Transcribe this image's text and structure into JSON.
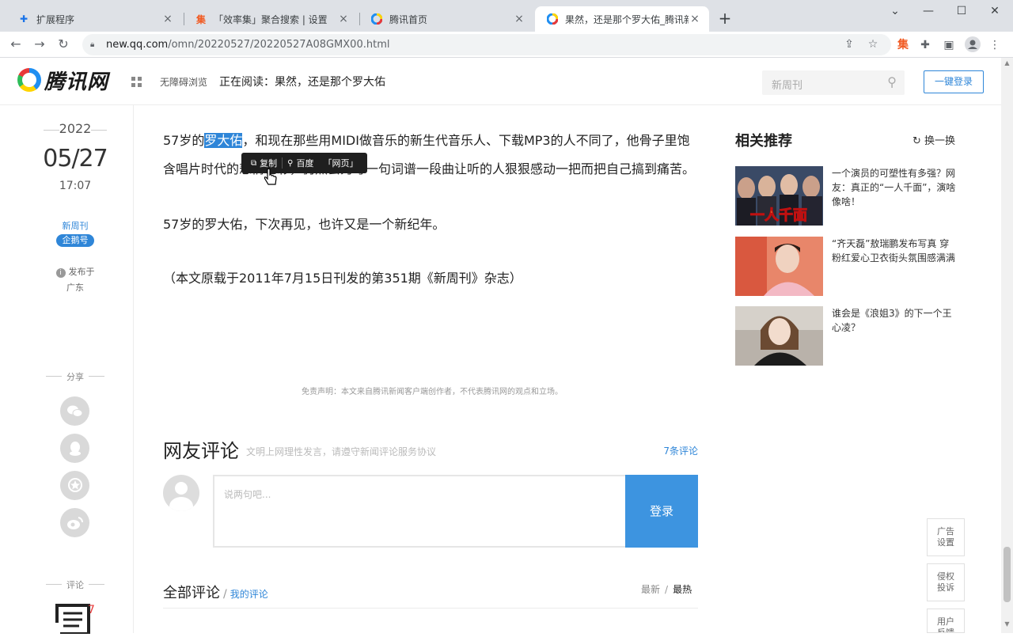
{
  "browser": {
    "tabs": [
      {
        "title": "扩展程序",
        "icon": "puzzle-icon"
      },
      {
        "title": "「效率集」聚合搜索 | 设置",
        "icon": "xiaolvji-icon"
      },
      {
        "title": "腾讯首页",
        "icon": "tencent-icon"
      },
      {
        "title": "果然，还是那个罗大佑_腾讯新闻",
        "icon": "tencent-icon"
      }
    ],
    "address": {
      "host": "new.qq.com",
      "path": "/omn/20220527/20220527A08GMX00.html"
    }
  },
  "header": {
    "logo_text": "腾讯网",
    "accessible": "无障碍浏览",
    "reading": "正在阅读：果然，还是那个罗大佑",
    "search_placeholder": "新周刊",
    "login": "一键登录"
  },
  "meta": {
    "year": "2022",
    "date": "05/27",
    "time": "17:07",
    "source": "新周刊",
    "badge": "企鹅号",
    "published_at": "发布于",
    "region": "广东",
    "share_label": "分享",
    "comment_label": "评论",
    "comment_count": "7"
  },
  "article": {
    "p1_prefix": "57岁的",
    "p1_highlight": "罗大佑",
    "p1_rest": "，和现在那些用MIDI做音乐的新生代音乐人、下载MP3的人不同了，他骨子里饱含唱片时代的悲情色彩，仍然会为写一句词谱一段曲让听的人狠狠感动一把而把自己搞到痛苦。",
    "p2": "57岁的罗大佑，下次再见，也许又是一个新纪年。",
    "p3": "（本文原载于2011年7月15日刊发的第351期《新周刊》杂志）",
    "disclaimer": "免责声明：本文来自腾讯新闻客户端创作者，不代表腾讯网的观点和立场。"
  },
  "context_menu": {
    "copy": "复制",
    "baidu": "百度",
    "web": "「网页」"
  },
  "comments": {
    "title": "网友评论",
    "subtitle": "文明上网理性发言，请遵守新闻评论服务协议",
    "count": "7条评论",
    "placeholder": "说两句吧...",
    "submit": "登录",
    "all": "全部评论",
    "mine": "我的评论",
    "sort_latest": "最新",
    "sort_hot": "最热"
  },
  "related": {
    "title": "相关推荐",
    "refresh": "换一换",
    "items": [
      {
        "text": "一个演员的可塑性有多强？网友：真正的“一人千面”，演啥像啥！",
        "thumb_caption": "一人千面"
      },
      {
        "text": "“齐天磊”敖瑞鹏发布写真 穿粉红爱心卫衣街头氛围感满满"
      },
      {
        "text": "谁会是《浪姐3》的下一个王心凌？"
      }
    ]
  },
  "side_tools": [
    {
      "line1": "广告",
      "line2": "设置"
    },
    {
      "line1": "侵权",
      "line2": "投诉"
    },
    {
      "line1": "用户",
      "line2": "反馈"
    }
  ]
}
